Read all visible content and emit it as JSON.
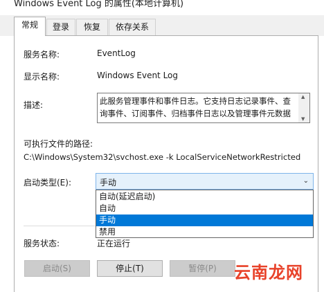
{
  "window": {
    "title": "Windows Event Log 的属性(本地计算机)"
  },
  "tabs": [
    {
      "label": "常规"
    },
    {
      "label": "登录"
    },
    {
      "label": "恢复"
    },
    {
      "label": "依存关系"
    }
  ],
  "general": {
    "service_name_label": "服务名称:",
    "service_name": "EventLog",
    "display_name_label": "显示名称:",
    "display_name": "Windows Event Log",
    "description_label": "描述:",
    "description": "此服务管理事件和事件日志。它支持日志记录事件、查\n询事件、订阅事件、归档事件日志以及管理事件元数据",
    "exe_path_label": "可执行文件的路径:",
    "exe_path": "C:\\Windows\\System32\\svchost.exe -k LocalServiceNetworkRestricted",
    "startup_type_label": "启动类型(E):",
    "startup_type_value": "手动",
    "startup_options": [
      "自动(延迟启动)",
      "自动",
      "手动",
      "禁用"
    ],
    "service_status_label": "服务状态:",
    "service_status": "正在运行"
  },
  "buttons": {
    "start": "启动(S)",
    "stop": "停止(T)",
    "pause": "暂停(P)"
  },
  "watermark": "云南龙网"
}
